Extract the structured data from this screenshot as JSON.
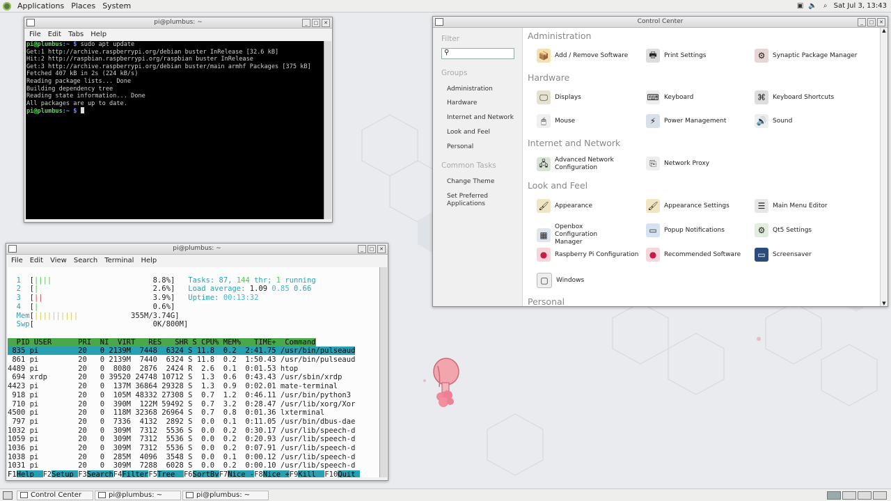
{
  "top_panel": {
    "menus": [
      "Applications",
      "Places",
      "System"
    ],
    "clock": "Sat Jul 3, 13:43"
  },
  "bottom_panel": {
    "tasks": [
      "Control Center",
      "pi@plumbus: ~",
      "pi@plumbus: ~"
    ]
  },
  "terminal1": {
    "title": "pi@plumbus: ~",
    "menu": [
      "File",
      "Edit",
      "Tabs",
      "Help"
    ],
    "prompt_user": "pi@plumbus",
    "prompt_path": ":~ $",
    "command": " sudo apt update",
    "output": [
      "Get:1 http://archive.raspberrypi.org/debian buster InRelease [32.6 kB]",
      "Hit:2 http://raspbian.raspberrypi.org/raspbian buster InRelease",
      "Get:3 http://archive.raspberrypi.org/debian buster/main armhf Packages [375 kB]",
      "Fetched 407 kB in 2s (224 kB/s)",
      "Reading package lists... Done",
      "Building dependency tree",
      "Reading state information... Done",
      "All packages are up to date."
    ]
  },
  "htop": {
    "title": "pi@plumbus: ~",
    "menu": [
      "File",
      "Edit",
      "View",
      "Search",
      "Terminal",
      "Help"
    ],
    "cpus": [
      {
        "n": "1",
        "bar": "||||",
        "pct": "8.8%"
      },
      {
        "n": "2",
        "bar": "|",
        "pct": "2.6%"
      },
      {
        "n": "3",
        "bar": "||",
        "pct": "3.9%"
      },
      {
        "n": "4",
        "bar": "|",
        "pct": "0.6%"
      }
    ],
    "mem_label": "Mem",
    "mem_bar": "||||||||||",
    "mem_val": "355M/3.74G",
    "swp_label": "Swp",
    "swp_val": "0K/800M",
    "tasks_label": "Tasks:",
    "tasks_n": "87,",
    "thr": "144",
    "thr_label": "thr;",
    "running": "1",
    "running_label": "running",
    "load_label": "Load average:",
    "load1": "1.09",
    "load5": "0.85",
    "load15": "0.66",
    "uptime_label": "Uptime:",
    "uptime": "00:13:32",
    "header": "  PID USER      PRI  NI  VIRT   RES   SHR S CPU% MEM%   TIME+  Command",
    "rows": [
      " 835 pi         20   0 2139M  7448  6324 S 11.8  0.2  2:41.75 /usr/bin/pulseaud",
      " 861 pi         20   0 2139M  7440  6324 S 11.8  0.2  1:50.43 /usr/bin/pulseaud",
      "4489 pi         20   0  8080  2876  2424 R  2.6  0.1  0:01.53 htop",
      " 694 xrdp       20   0 39520 24748 10712 S  1.3  0.6  0:43.43 /usr/sbin/xrdp",
      "4423 pi         20   0  137M 36864 29328 S  1.3  0.9  0:02.01 mate-terminal",
      " 918 pi         20   0  105M 48332 27308 S  0.7  1.2  0:46.11 /usr/bin/python3",
      " 710 pi         20   0  390M  122M 59492 S  0.7  3.2  0:28.47 /usr/lib/xorg/Xor",
      "4500 pi         20   0  118M 32368 26964 S  0.7  0.8  0:01.36 lxterminal",
      " 797 pi         20   0  7336  4132  2892 S  0.0  0.1  0:11.05 /usr/bin/dbus-dae",
      "1032 pi         20   0  309M  7312  5536 S  0.0  0.2  0:30.17 /usr/lib/speech-d",
      "1059 pi         20   0  309M  7312  5536 S  0.0  0.2  0:20.93 /usr/lib/speech-d",
      "1036 pi         20   0  309M  7312  5536 S  0.0  0.2  0:07.91 /usr/lib/speech-d",
      "1038 pi         20   0  285M  4096  3548 S  0.0  0.1  0:00.12 /usr/lib/speech-d",
      "1031 pi         20   0  309M  7288  6028 S  0.0  0.2  0:00.10 /usr/lib/speech-d"
    ],
    "fkeys": [
      {
        "k": "F1",
        "l": "Help  "
      },
      {
        "k": "F2",
        "l": "Setup "
      },
      {
        "k": "F3",
        "l": "Search"
      },
      {
        "k": "F4",
        "l": "Filter"
      },
      {
        "k": "F5",
        "l": "Tree  "
      },
      {
        "k": "F6",
        "l": "SortBy"
      },
      {
        "k": "F7",
        "l": "Nice -"
      },
      {
        "k": "F8",
        "l": "Nice +"
      },
      {
        "k": "F9",
        "l": "Kill  "
      },
      {
        "k": "F10",
        "l": "Quit "
      }
    ]
  },
  "control_center": {
    "title": "Control Center",
    "filter_label": "Filter",
    "groups_label": "Groups",
    "groups": [
      "Administration",
      "Hardware",
      "Internet and Network",
      "Look and Feel",
      "Personal"
    ],
    "common_tasks_label": "Common Tasks",
    "tasks": [
      "Change Theme",
      "Set Preferred Applications"
    ],
    "sections": {
      "administration": "Administration",
      "hardware": "Hardware",
      "internet": "Internet and Network",
      "look": "Look and Feel",
      "personal": "Personal"
    },
    "items": {
      "add_remove": "Add / Remove Software",
      "print": "Print Settings",
      "synaptic": "Synaptic Package Manager",
      "displays": "Displays",
      "keyboard": "Keyboard",
      "kb_shortcuts": "Keyboard Shortcuts",
      "mouse": "Mouse",
      "power": "Power Management",
      "sound": "Sound",
      "adv_net": "Advanced Network Configuration",
      "net_proxy": "Network Proxy",
      "appearance": "Appearance",
      "appearance_settings": "Appearance Settings",
      "main_menu": "Main Menu Editor",
      "openbox": "Openbox Configuration Manager",
      "popup": "Popup Notifications",
      "qt5": "Qt5 Settings",
      "rpi_config": "Raspberry Pi Configuration",
      "recommended": "Recommended Software",
      "screensaver": "Screensaver",
      "windows": "Windows"
    }
  }
}
